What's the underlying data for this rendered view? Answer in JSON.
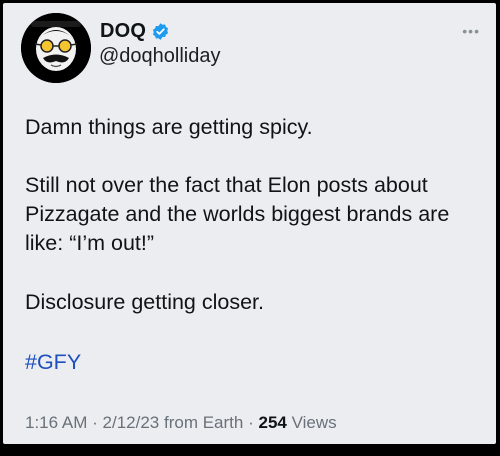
{
  "author": {
    "display_name": "DOQ",
    "handle": "@doqholliday",
    "verified": true
  },
  "more_icon": "more-dots-icon",
  "tweet": {
    "lines": [
      "Damn things are getting spicy.",
      "Still not over the fact that Elon posts about Pizzagate and the worlds biggest brands are like: “I’m out!”",
      "Disclosure getting closer."
    ],
    "hashtag": "#GFY"
  },
  "meta": {
    "time": "1:16 AM",
    "separator": "·",
    "date": "2/12/23",
    "source": "from Earth",
    "views_count": "254",
    "views_label": "Views"
  },
  "colors": {
    "background": "#ecedf0",
    "hashtag": "#1d4fbf",
    "verified": "#1d9bf0"
  }
}
